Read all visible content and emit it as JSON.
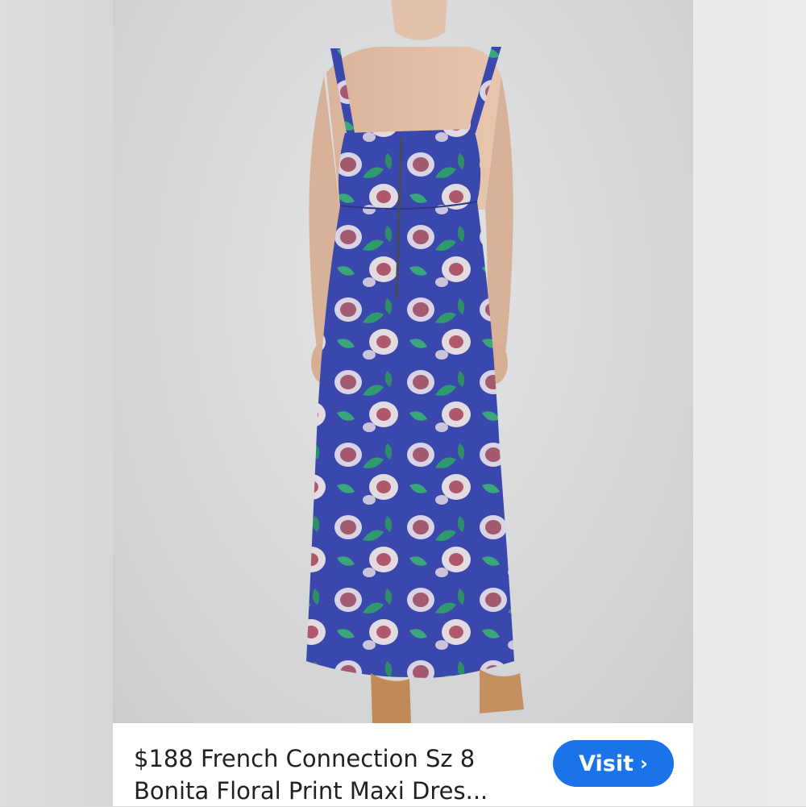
{
  "listing": {
    "title": "$188 French Connection Sz 8\nBonita Floral Print Maxi Dres...",
    "visit_label": "Visit",
    "visit_icon": "chevron-right-icon"
  },
  "image": {
    "description_icon": "product-photo"
  },
  "colors": {
    "button": "#1a73e8",
    "dress_base": "#3a49b0",
    "background": "#d9dadc"
  }
}
